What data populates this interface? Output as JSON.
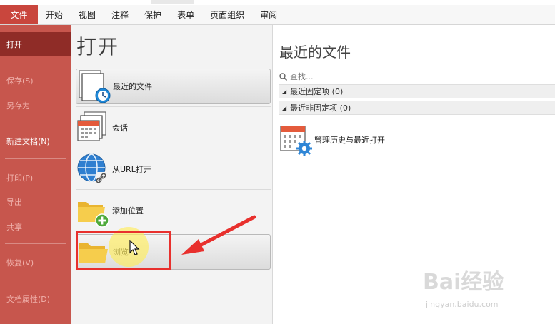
{
  "titlebar": {
    "ghost_text": ""
  },
  "ribbon": {
    "tabs": [
      "文件",
      "开始",
      "视图",
      "注释",
      "保护",
      "表单",
      "页面组织",
      "审阅"
    ]
  },
  "leftmenu": {
    "items": [
      "打开",
      "保存(S)",
      "另存为",
      "新建文档(N)",
      "打印(P)",
      "导出",
      "共享",
      "恢复(V)",
      "文档属性(D)"
    ]
  },
  "open_panel": {
    "title": "打开",
    "options": [
      "最近的文件",
      "会话",
      "从URL打开",
      "添加位置",
      "浏览"
    ]
  },
  "recent_panel": {
    "title": "最近的文件",
    "search_placeholder": "查找...",
    "pinned_group": "最近固定项 (0)",
    "unpinned_group": "最近非固定项 (0)",
    "manage_label": "管理历史与最近打开"
  },
  "watermark": {
    "brand": "Bai经验",
    "url": "jingyan.baidu.com"
  },
  "colors": {
    "accent_red": "#c7564d",
    "active_red": "#8f2c27",
    "highlight": "#e8302d",
    "folder_yellow": "#f5c842"
  }
}
